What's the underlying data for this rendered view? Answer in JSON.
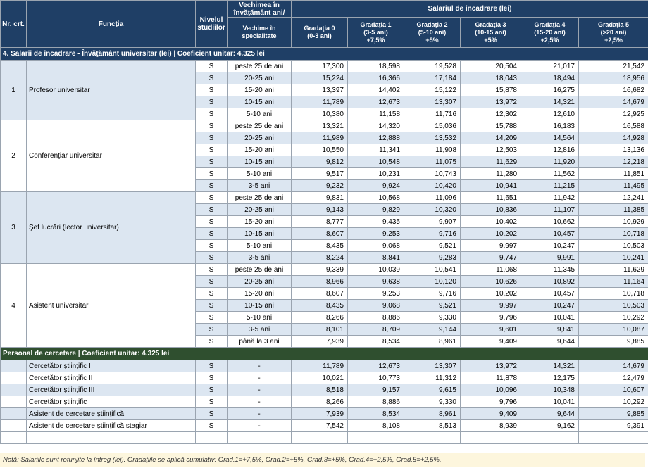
{
  "headers": {
    "nr": "Nr. crt.",
    "functia": "Funcţia",
    "nivel": "Nivelul studiilor",
    "vechime_top": "Vechimea în învăţământ ani/",
    "vechime_spec": "Vechime în specialitate",
    "salariu": "Salariul de încadrare (lei)",
    "gradatii": [
      {
        "l1": "Gradaţia 0",
        "l2": "(0-3 ani)",
        "l3": ""
      },
      {
        "l1": "Gradaţia 1",
        "l2": "(3-5 ani)",
        "l3": "+7,5%"
      },
      {
        "l1": "Gradaţia 2",
        "l2": "(5-10 ani)",
        "l3": "+5%"
      },
      {
        "l1": "Gradaţia 3",
        "l2": "(10-15 ani)",
        "l3": "+5%"
      },
      {
        "l1": "Gradaţia 4",
        "l2": "(15-20 ani)",
        "l3": "+2,5%"
      },
      {
        "l1": "Gradaţia 5",
        "l2": "(>20 ani)",
        "l3": "+2,5%"
      }
    ]
  },
  "section1": {
    "title": "4. Salarii de încadrare - Învăţământ universitar (lei) | Coeficient unitar: 4.325 lei",
    "groups": [
      {
        "nr": "1",
        "functie": "Profesor universitar",
        "rows": [
          {
            "nivel": "S",
            "vechime": "peste 25 de ani",
            "v": [
              "17,300",
              "18,598",
              "19,528",
              "20,504",
              "21,017",
              "21,542"
            ]
          },
          {
            "nivel": "S",
            "vechime": "20-25 ani",
            "v": [
              "15,224",
              "16,366",
              "17,184",
              "18,043",
              "18,494",
              "18,956"
            ]
          },
          {
            "nivel": "S",
            "vechime": "15-20 ani",
            "v": [
              "13,397",
              "14,402",
              "15,122",
              "15,878",
              "16,275",
              "16,682"
            ]
          },
          {
            "nivel": "S",
            "vechime": "10-15 ani",
            "v": [
              "11,789",
              "12,673",
              "13,307",
              "13,972",
              "14,321",
              "14,679"
            ]
          },
          {
            "nivel": "S",
            "vechime": "5-10 ani",
            "v": [
              "10,380",
              "11,158",
              "11,716",
              "12,302",
              "12,610",
              "12,925"
            ]
          }
        ]
      },
      {
        "nr": "2",
        "functie": "Conferenţiar universitar",
        "rows": [
          {
            "nivel": "S",
            "vechime": "peste 25 de ani",
            "v": [
              "13,321",
              "14,320",
              "15,036",
              "15,788",
              "16,183",
              "16,588"
            ]
          },
          {
            "nivel": "S",
            "vechime": "20-25 ani",
            "v": [
              "11,989",
              "12,888",
              "13,532",
              "14,209",
              "14,564",
              "14,928"
            ]
          },
          {
            "nivel": "S",
            "vechime": "15-20 ani",
            "v": [
              "10,550",
              "11,341",
              "11,908",
              "12,503",
              "12,816",
              "13,136"
            ]
          },
          {
            "nivel": "S",
            "vechime": "10-15 ani",
            "v": [
              "9,812",
              "10,548",
              "11,075",
              "11,629",
              "11,920",
              "12,218"
            ]
          },
          {
            "nivel": "S",
            "vechime": "5-10 ani",
            "v": [
              "9,517",
              "10,231",
              "10,743",
              "11,280",
              "11,562",
              "11,851"
            ]
          },
          {
            "nivel": "S",
            "vechime": "3-5 ani",
            "v": [
              "9,232",
              "9,924",
              "10,420",
              "10,941",
              "11,215",
              "11,495"
            ]
          }
        ]
      },
      {
        "nr": "3",
        "functie": "Şef lucrări (lector universitar)",
        "rows": [
          {
            "nivel": "S",
            "vechime": "peste 25 de ani",
            "v": [
              "9,831",
              "10,568",
              "11,096",
              "11,651",
              "11,942",
              "12,241"
            ]
          },
          {
            "nivel": "S",
            "vechime": "20-25 ani",
            "v": [
              "9,143",
              "9,829",
              "10,320",
              "10,836",
              "11,107",
              "11,385"
            ]
          },
          {
            "nivel": "S",
            "vechime": "15-20 ani",
            "v": [
              "8,777",
              "9,435",
              "9,907",
              "10,402",
              "10,662",
              "10,929"
            ]
          },
          {
            "nivel": "S",
            "vechime": "10-15 ani",
            "v": [
              "8,607",
              "9,253",
              "9,716",
              "10,202",
              "10,457",
              "10,718"
            ]
          },
          {
            "nivel": "S",
            "vechime": "5-10 ani",
            "v": [
              "8,435",
              "9,068",
              "9,521",
              "9,997",
              "10,247",
              "10,503"
            ]
          },
          {
            "nivel": "S",
            "vechime": "3-5 ani",
            "v": [
              "8,224",
              "8,841",
              "9,283",
              "9,747",
              "9,991",
              "10,241"
            ]
          }
        ]
      },
      {
        "nr": "4",
        "functie": "Asistent universitar",
        "rows": [
          {
            "nivel": "S",
            "vechime": "peste 25 de ani",
            "v": [
              "9,339",
              "10,039",
              "10,541",
              "11,068",
              "11,345",
              "11,629"
            ]
          },
          {
            "nivel": "S",
            "vechime": "20-25 ani",
            "v": [
              "8,966",
              "9,638",
              "10,120",
              "10,626",
              "10,892",
              "11,164"
            ]
          },
          {
            "nivel": "S",
            "vechime": "15-20 ani",
            "v": [
              "8,607",
              "9,253",
              "9,716",
              "10,202",
              "10,457",
              "10,718"
            ]
          },
          {
            "nivel": "S",
            "vechime": "10-15 ani",
            "v": [
              "8,435",
              "9,068",
              "9,521",
              "9,997",
              "10,247",
              "10,503"
            ]
          },
          {
            "nivel": "S",
            "vechime": "5-10 ani",
            "v": [
              "8,266",
              "8,886",
              "9,330",
              "9,796",
              "10,041",
              "10,292"
            ]
          },
          {
            "nivel": "S",
            "vechime": "3-5 ani",
            "v": [
              "8,101",
              "8,709",
              "9,144",
              "9,601",
              "9,841",
              "10,087"
            ]
          },
          {
            "nivel": "S",
            "vechime": "până la 3 ani",
            "v": [
              "7,939",
              "8,534",
              "8,961",
              "9,409",
              "9,644",
              "9,885"
            ]
          }
        ]
      }
    ]
  },
  "section2": {
    "title": "Personal de cercetare | Coeficient unitar: 4.325 lei",
    "rows": [
      {
        "functie": "Cercetător ştiinţific I",
        "nivel": "S",
        "vechime": "-",
        "v": [
          "11,789",
          "12,673",
          "13,307",
          "13,972",
          "14,321",
          "14,679"
        ]
      },
      {
        "functie": "Cercetător ştiinţific II",
        "nivel": "S",
        "vechime": "-",
        "v": [
          "10,021",
          "10,773",
          "11,312",
          "11,878",
          "12,175",
          "12,479"
        ]
      },
      {
        "functie": "Cercetător ştiinţific III",
        "nivel": "S",
        "vechime": "-",
        "v": [
          "8,518",
          "9,157",
          "9,615",
          "10,096",
          "10,348",
          "10,607"
        ]
      },
      {
        "functie": "Cercetător ştiinţific",
        "nivel": "S",
        "vechime": "-",
        "v": [
          "8,266",
          "8,886",
          "9,330",
          "9,796",
          "10,041",
          "10,292"
        ]
      },
      {
        "functie": "Asistent de cercetare ştiinţifică",
        "nivel": "S",
        "vechime": "-",
        "v": [
          "7,939",
          "8,534",
          "8,961",
          "9,409",
          "9,644",
          "9,885"
        ]
      },
      {
        "functie": "Asistent de cercetare ştiinţifică stagiar",
        "nivel": "S",
        "vechime": "-",
        "v": [
          "7,542",
          "8,108",
          "8,513",
          "8,939",
          "9,162",
          "9,391"
        ]
      }
    ]
  },
  "note": "Notă: Salariile sunt rotunjite la întreg (lei). Gradaţiile se aplică cumulativ: Grad.1=+7,5%, Grad.2=+5%, Grad.3=+5%, Grad.4=+2,5%, Grad.5=+2,5%."
}
